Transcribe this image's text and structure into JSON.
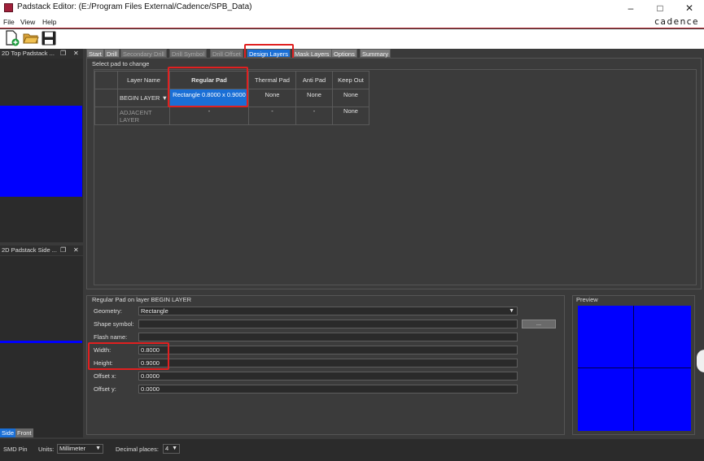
{
  "window": {
    "title": "Padstack Editor:  (E:/Program Files External/Cadence/SPB_Data)"
  },
  "menu": {
    "items": [
      "File",
      "View",
      "Help"
    ]
  },
  "brand": "cadence",
  "toolbar": {
    "icons": [
      "new-file-icon",
      "open-folder-icon",
      "save-icon"
    ]
  },
  "docks": {
    "top": {
      "title": "2D Top Padstack ..."
    },
    "side": {
      "title": "2D Padstack Side ..."
    },
    "view_tabs": [
      "Side",
      "Front"
    ]
  },
  "tabs": [
    "Start",
    "Drill",
    "Secondary Drill",
    "Drill Symbol",
    "Drill Offset",
    "Design Layers",
    "Mask Layers",
    "Options",
    "Summary"
  ],
  "design_layers": {
    "section_label": "Select pad to change",
    "columns": [
      "Layer Name",
      "Regular Pad",
      "Thermal Pad",
      "Anti Pad",
      "Keep Out"
    ],
    "rows": [
      {
        "layer": "BEGIN LAYER",
        "regular": "Rectangle 0.8000 x 0.9000",
        "thermal": "None",
        "anti": "None",
        "keepout": "None"
      },
      {
        "layer": "ADJACENT LAYER",
        "regular": "-",
        "thermal": "-",
        "anti": "-",
        "keepout": "None"
      }
    ]
  },
  "pad_props": {
    "section_label": "Regular Pad on layer BEGIN LAYER",
    "geometry_label": "Geometry:",
    "geometry_value": "Rectangle",
    "shape_label": "Shape symbol:",
    "shape_value": "",
    "browse_button": "...",
    "flash_label": "Flash name:",
    "flash_value": "",
    "width_label": "Width:",
    "width_value": "0.8000",
    "height_label": "Height:",
    "height_value": "0.9000",
    "offx_label": "Offset x:",
    "offx_value": "0.0000",
    "offy_label": "Offset y:",
    "offy_value": "0.0000"
  },
  "preview": {
    "label": "Preview",
    "color": "#0000ff"
  },
  "status": {
    "pin_type": "SMD Pin",
    "units_label": "Units:",
    "units_value": "Millimeter",
    "decimal_label": "Decimal places:",
    "decimal_value": "4"
  },
  "colors": {
    "accent": "#1a6fd6",
    "pad": "#0000ff",
    "highlight": "#e02020"
  }
}
